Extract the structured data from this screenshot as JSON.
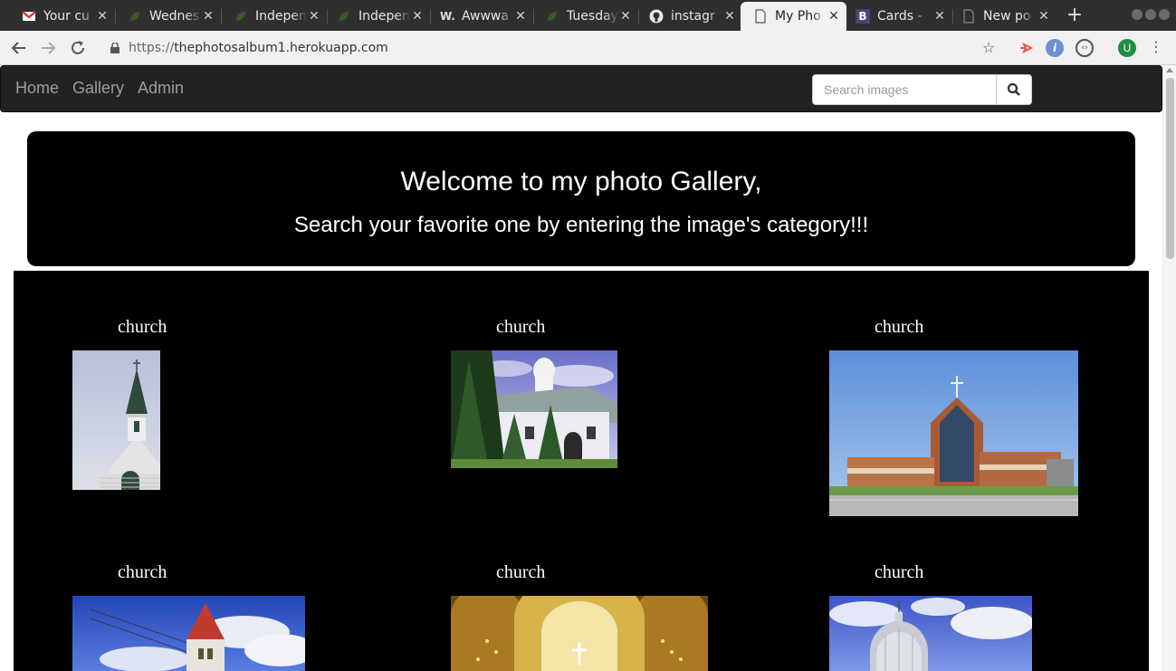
{
  "browser": {
    "tabs": [
      {
        "title": "Your cu",
        "icon": "gmail-icon"
      },
      {
        "title": "Wednes",
        "icon": "leaf-icon"
      },
      {
        "title": "Indepen",
        "icon": "leaf-icon"
      },
      {
        "title": "Indepen",
        "icon": "leaf-icon"
      },
      {
        "title": "Awwwa",
        "icon": "awwwards-icon",
        "icon_text": "W."
      },
      {
        "title": "Tuesday",
        "icon": "leaf-icon"
      },
      {
        "title": "instagr",
        "icon": "github-icon"
      },
      {
        "title": "My Pho",
        "icon": "page-icon",
        "active": true
      },
      {
        "title": "Cards -",
        "icon": "bootstrap-icon",
        "icon_text": "B"
      },
      {
        "title": "New po",
        "icon": "page-icon"
      }
    ],
    "url_protocol": "https://",
    "url_host": "thephotosalbum1.herokuapp.com",
    "profile_initial": "U",
    "colors": {
      "accent_profile": "#1e8e3e",
      "bootstrap": "#563d7c"
    }
  },
  "nav": {
    "links": [
      "Home",
      "Gallery",
      "Admin"
    ],
    "search_placeholder": "Search images"
  },
  "hero": {
    "title": "Welcome to my photo Gallery,",
    "subtitle": "Search your favorite one by entering the image's category!!!"
  },
  "gallery": {
    "items": [
      {
        "caption": "church",
        "subject": "steeple"
      },
      {
        "caption": "church",
        "subject": "white-church"
      },
      {
        "caption": "church",
        "subject": "modern-church"
      },
      {
        "caption": "church",
        "subject": "red-spire"
      },
      {
        "caption": "church",
        "subject": "golden-interior"
      },
      {
        "caption": "church",
        "subject": "domed-church"
      }
    ]
  }
}
